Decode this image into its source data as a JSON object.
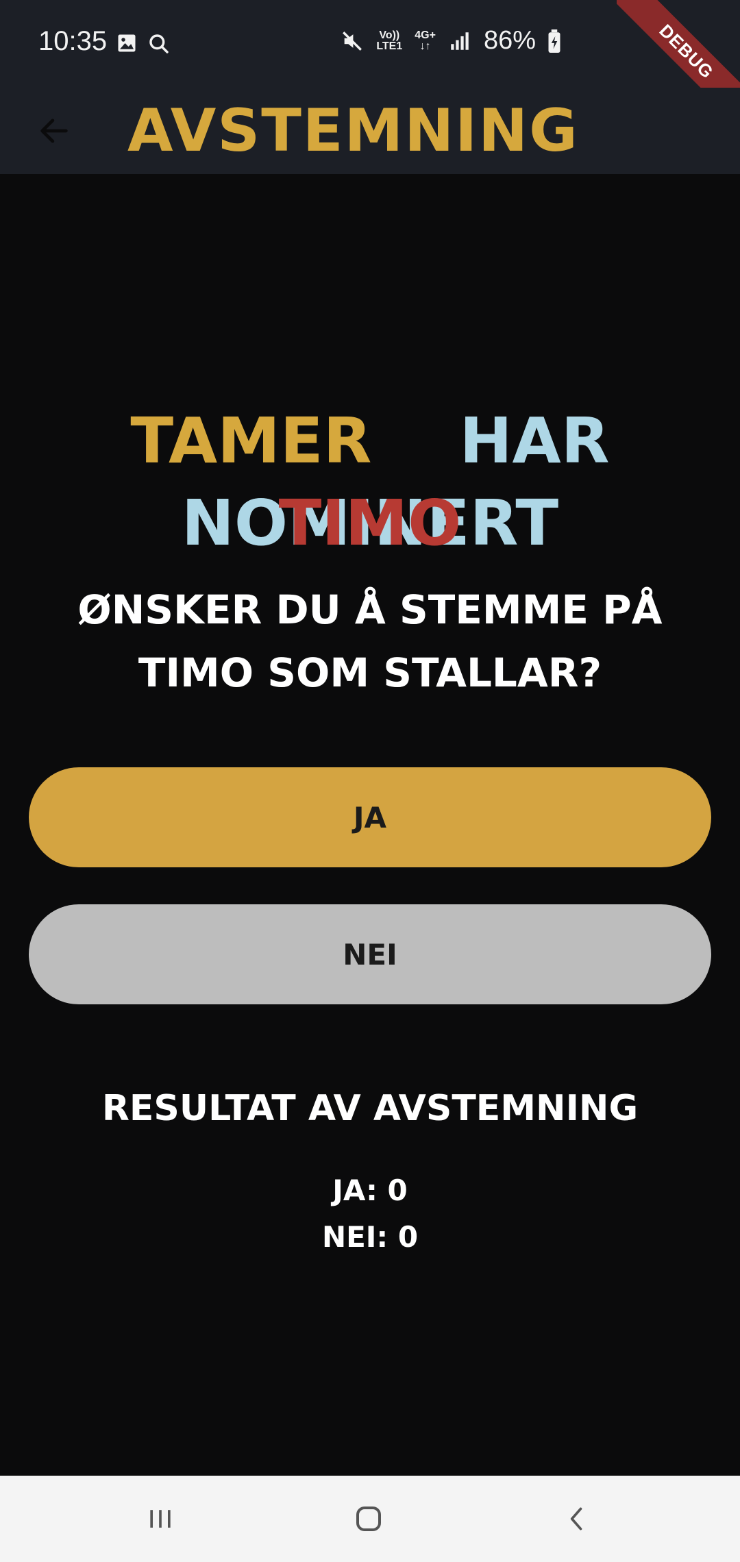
{
  "status_bar": {
    "time": "10:35",
    "volte_line1": "Vo))",
    "volte_line2": "LTE1",
    "network_type": "4G+",
    "battery_percent": "86%"
  },
  "debug_banner": {
    "label": "DEBUG"
  },
  "app_bar": {
    "title": "AVSTEMNING"
  },
  "nomination": {
    "nominator": "TAMER",
    "nominated_text": "HAR NOMINERT",
    "nominee": "TIMO"
  },
  "question": {
    "text": "ØNSKER DU Å STEMME PÅ TIMO SOM STALLAR?"
  },
  "buttons": {
    "yes": "JA",
    "no": "NEI"
  },
  "results": {
    "title": "RESULTAT AV AVSTEMNING",
    "yes_label": "JA:",
    "yes_count": "0",
    "no_label": "NEI:",
    "no_count": "0"
  },
  "colors": {
    "accent_gold": "#d4a441",
    "nominated_blue": "#aed7e6",
    "nominee_red": "#b73a33",
    "button_grey": "#bdbdbd",
    "bar_background": "#1c1f26",
    "page_background": "#0b0b0c"
  },
  "icons": {
    "status_left": [
      "gallery-icon",
      "search-icon"
    ],
    "status_right": [
      "mute-icon",
      "signal-icon",
      "battery-charging-icon"
    ],
    "app_bar": [
      "back-arrow-icon"
    ],
    "navigation": [
      "recents-icon",
      "home-icon",
      "nav-back-icon"
    ]
  }
}
